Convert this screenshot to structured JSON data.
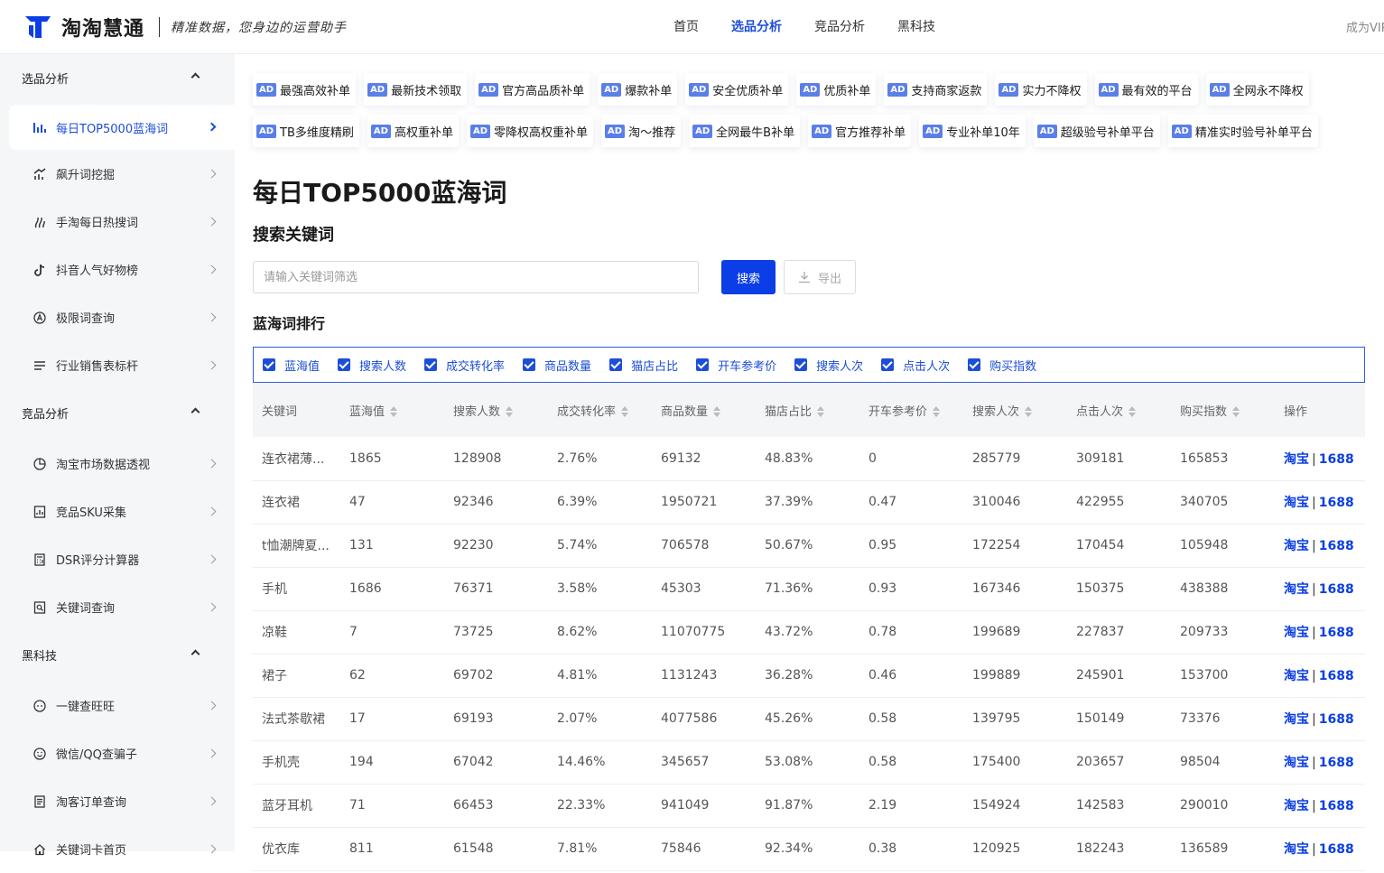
{
  "brand": {
    "name": "淘淘慧通",
    "slogan": "精准数据，您身边的运营助手"
  },
  "topnav": [
    {
      "label": "首页",
      "active": false
    },
    {
      "label": "选品分析",
      "active": true
    },
    {
      "label": "竞品分析",
      "active": false
    },
    {
      "label": "黑科技",
      "active": false
    }
  ],
  "vip_label": "成为VIP",
  "sidebar": {
    "groups": [
      {
        "title": "选品分析",
        "items": [
          {
            "label": "每日TOP5000蓝海词",
            "icon": "bar-chart-icon",
            "active": true
          },
          {
            "label": "飙升词挖掘",
            "icon": "trend-up-icon"
          },
          {
            "label": "手淘每日热搜词",
            "icon": "flame-icon"
          },
          {
            "label": "抖音人气好物榜",
            "icon": "tiktok-icon"
          },
          {
            "label": "极限词查询",
            "icon": "circle-a-icon"
          },
          {
            "label": "行业销售表标杆",
            "icon": "list-icon"
          }
        ]
      },
      {
        "title": "竞品分析",
        "items": [
          {
            "label": "淘宝市场数据透视",
            "icon": "pie-chart-icon"
          },
          {
            "label": "竞品SKU采集",
            "icon": "report-icon"
          },
          {
            "label": "DSR评分计算器",
            "icon": "calculator-icon"
          },
          {
            "label": "关键词查询",
            "icon": "search-doc-icon"
          }
        ]
      },
      {
        "title": "黑科技",
        "items": [
          {
            "label": "一键查旺旺",
            "icon": "face-icon"
          },
          {
            "label": "微信/QQ查骗子",
            "icon": "smile-icon"
          },
          {
            "label": "淘客订单查询",
            "icon": "document-icon"
          },
          {
            "label": "关键词卡首页",
            "icon": "home-icon"
          }
        ]
      }
    ]
  },
  "ad_badge": "AD",
  "ads_row1": [
    "最强高效补单",
    "最新技术领取",
    "官方高品质补单",
    "爆款补单",
    "安全优质补单",
    "优质补单",
    "支持商家返款",
    "实力不降权",
    "最有效的平台",
    "全网永不降权"
  ],
  "ads_row2": [
    "TB多维度精刷",
    "高权重补单",
    "零降权高权重补单",
    "淘～推荐",
    "全网最牛B补单",
    "官方推荐补单",
    "专业补单10年",
    "超级验号补单平台",
    "精准实时验号补单平台"
  ],
  "page_title": "每日TOP5000蓝海词",
  "search": {
    "title": "搜索关键词",
    "placeholder": "请输入关键词筛选",
    "button": "搜索",
    "export": "导出"
  },
  "rank_title": "蓝海词排行",
  "filters": [
    "蓝海值",
    "搜索人数",
    "成交转化率",
    "商品数量",
    "猫店占比",
    "开车参考价",
    "搜索人次",
    "点击人次",
    "购买指数"
  ],
  "table": {
    "columns": [
      "关键词",
      "蓝海值",
      "搜索人数",
      "成交转化率",
      "商品数量",
      "猫店占比",
      "开车参考价",
      "搜索人次",
      "点击人次",
      "购买指数",
      "操作"
    ],
    "link_taobao": "淘宝",
    "link_1688": "1688",
    "rows": [
      [
        "连衣裙薄...",
        "1865",
        "128908",
        "2.76%",
        "69132",
        "48.83%",
        "0",
        "285779",
        "309181",
        "165853"
      ],
      [
        "连衣裙",
        "47",
        "92346",
        "6.39%",
        "1950721",
        "37.39%",
        "0.47",
        "310046",
        "422955",
        "340705"
      ],
      [
        "t恤潮牌夏...",
        "131",
        "92230",
        "5.74%",
        "706578",
        "50.67%",
        "0.95",
        "172254",
        "170454",
        "105948"
      ],
      [
        "手机",
        "1686",
        "76371",
        "3.58%",
        "45303",
        "71.36%",
        "0.93",
        "167346",
        "150375",
        "438388"
      ],
      [
        "凉鞋",
        "7",
        "73725",
        "8.62%",
        "11070775",
        "43.72%",
        "0.78",
        "199689",
        "227837",
        "209733"
      ],
      [
        "裙子",
        "62",
        "69702",
        "4.81%",
        "1131243",
        "36.28%",
        "0.46",
        "199889",
        "245901",
        "153700"
      ],
      [
        "法式茶歇裙",
        "17",
        "69193",
        "2.07%",
        "4077586",
        "45.26%",
        "0.58",
        "139795",
        "150149",
        "73376"
      ],
      [
        "手机壳",
        "194",
        "67042",
        "14.46%",
        "345657",
        "53.08%",
        "0.58",
        "175400",
        "203657",
        "98504"
      ],
      [
        "蓝牙耳机",
        "71",
        "66453",
        "22.33%",
        "941049",
        "91.87%",
        "2.19",
        "154924",
        "142583",
        "290010"
      ],
      [
        "优衣库",
        "811",
        "61548",
        "7.81%",
        "75846",
        "92.34%",
        "0.38",
        "120925",
        "182243",
        "136589"
      ]
    ]
  }
}
